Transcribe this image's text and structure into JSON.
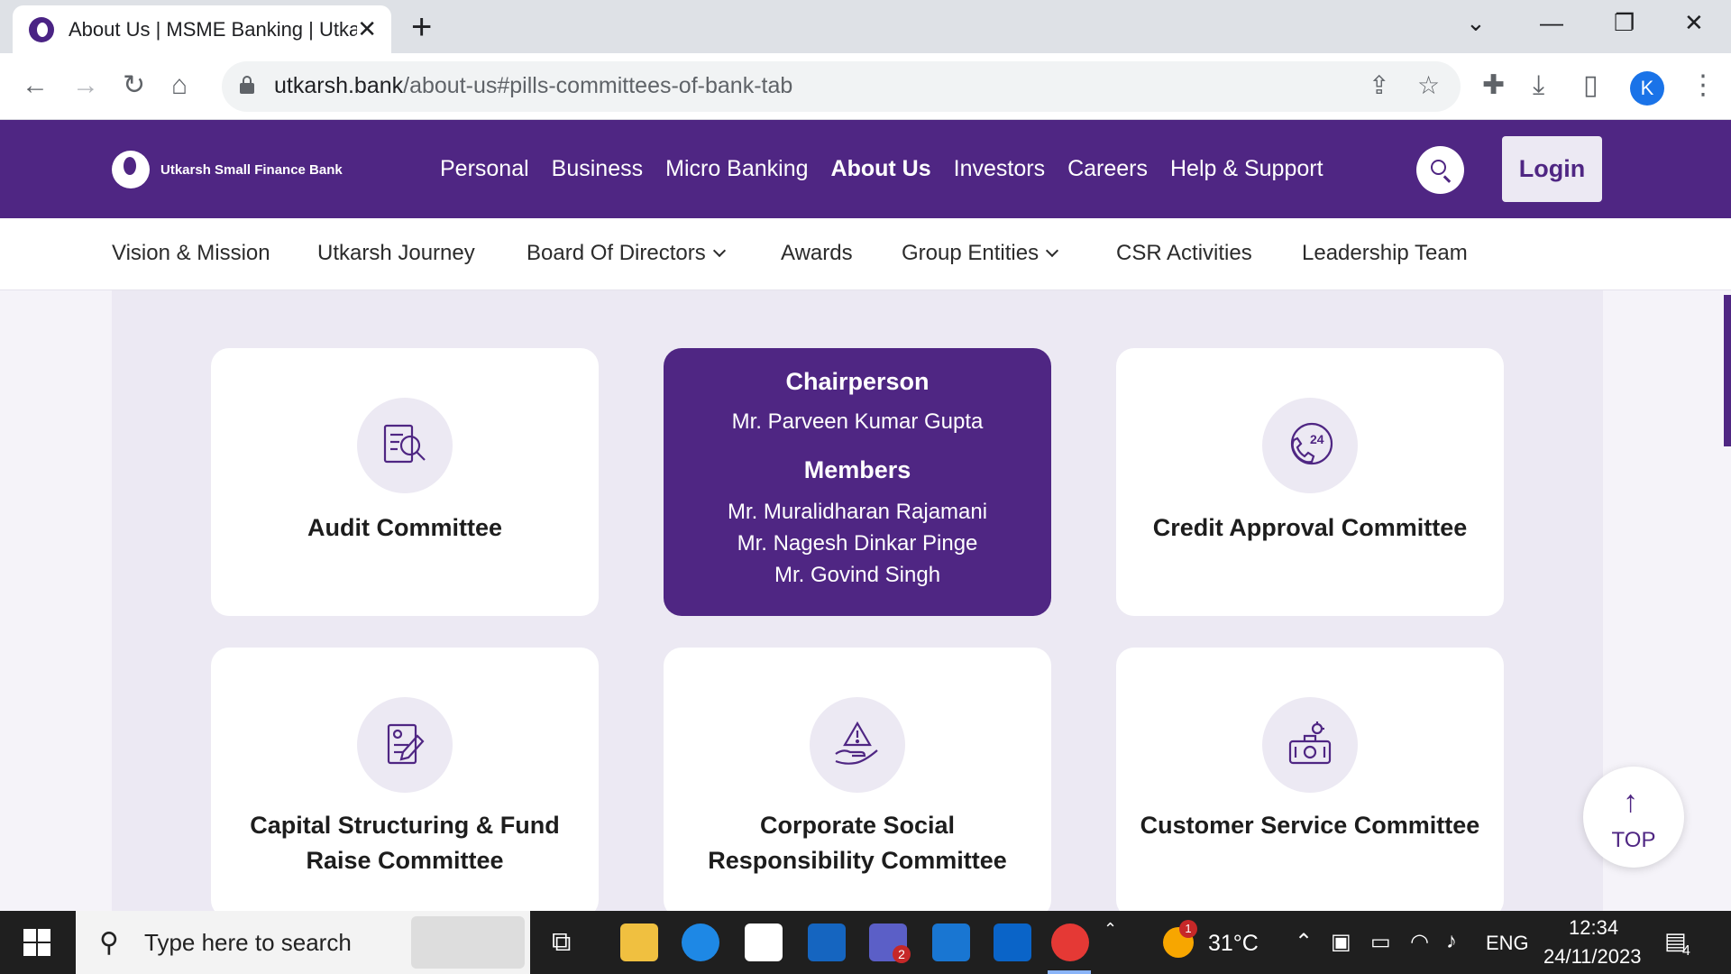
{
  "browser": {
    "tab_title": "About Us | MSME Banking | Utkarsh",
    "url_host": "utkarsh.bank",
    "url_path": "/about-us#pills-committees-of-bank-tab",
    "profile_initial": "K",
    "icons": [
      "back-icon",
      "forward-icon",
      "reload-icon",
      "home-icon",
      "lock-icon",
      "share-icon",
      "star-icon",
      "extensions-icon",
      "download-icon",
      "sidepanel-icon",
      "menu-icon"
    ]
  },
  "site": {
    "logo_text": "Utkarsh Small Finance Bank",
    "nav": [
      "Personal",
      "Business",
      "Micro Banking",
      "About Us",
      "Investors",
      "Careers",
      "Help & Support"
    ],
    "active_nav": "About Us",
    "login_label": "Login",
    "brand_color": "#4f2683"
  },
  "subnav": {
    "vision": "Vision & Mission",
    "journey": "Utkarsh Journey",
    "board": "Board Of Directors",
    "awards": "Awards",
    "group": "Group Entities",
    "csr": "CSR Activities",
    "leadership": "Leadership Team"
  },
  "committees": {
    "audit": "Audit Committee",
    "credit": "Credit Approval Committee",
    "capital": "Capital Structuring & Fund Raise Committee",
    "csr": "Corporate Social Responsibility Committee",
    "customer": "Customer Service Committee",
    "active_card": {
      "chair_label": "Chairperson",
      "chair_name": "Mr. Parveen Kumar Gupta",
      "members_label": "Members",
      "member_1": "Mr. Muralidharan Rajamani",
      "member_2": "Mr. Nagesh Dinkar Pinge",
      "member_3": "Mr. Govind Singh"
    },
    "credit_icon_text": "24"
  },
  "top_button": {
    "label": "TOP"
  },
  "taskbar": {
    "search_placeholder": "Type here to search",
    "teams_badge": "2",
    "weather_badge": "1",
    "temperature": "31°C",
    "language": "ENG",
    "time": "12:34",
    "date": "24/11/2023",
    "notifications": "4"
  }
}
